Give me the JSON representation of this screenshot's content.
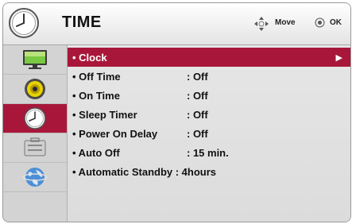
{
  "header": {
    "title": "TIME",
    "icon": "clock-icon",
    "hints": {
      "move_label": "Move",
      "ok_label": "OK"
    }
  },
  "sidebar": {
    "items": [
      {
        "icon": "picture-icon",
        "active": false
      },
      {
        "icon": "speaker-icon",
        "active": false
      },
      {
        "icon": "clock-icon",
        "active": true
      },
      {
        "icon": "toolbox-icon",
        "active": false
      },
      {
        "icon": "globe-icon",
        "active": false
      }
    ]
  },
  "menu": {
    "items": [
      {
        "label": "• Clock",
        "value": "",
        "selected": true
      },
      {
        "label": "• Off Time",
        "value": ": Off"
      },
      {
        "label": "• On Time",
        "value": ": Off"
      },
      {
        "label": "• Sleep Timer",
        "value": ": Off"
      },
      {
        "label": "• Power On Delay",
        "value": ": Off"
      },
      {
        "label": "• Auto Off",
        "value": ": 15 min."
      },
      {
        "label": "• Automatic Standby : 4hours",
        "value": ""
      }
    ]
  },
  "colors": {
    "accent": "#a8173a",
    "sidebar_bg": "#d3d3d3",
    "menu_bg": "#e3e3e3"
  }
}
